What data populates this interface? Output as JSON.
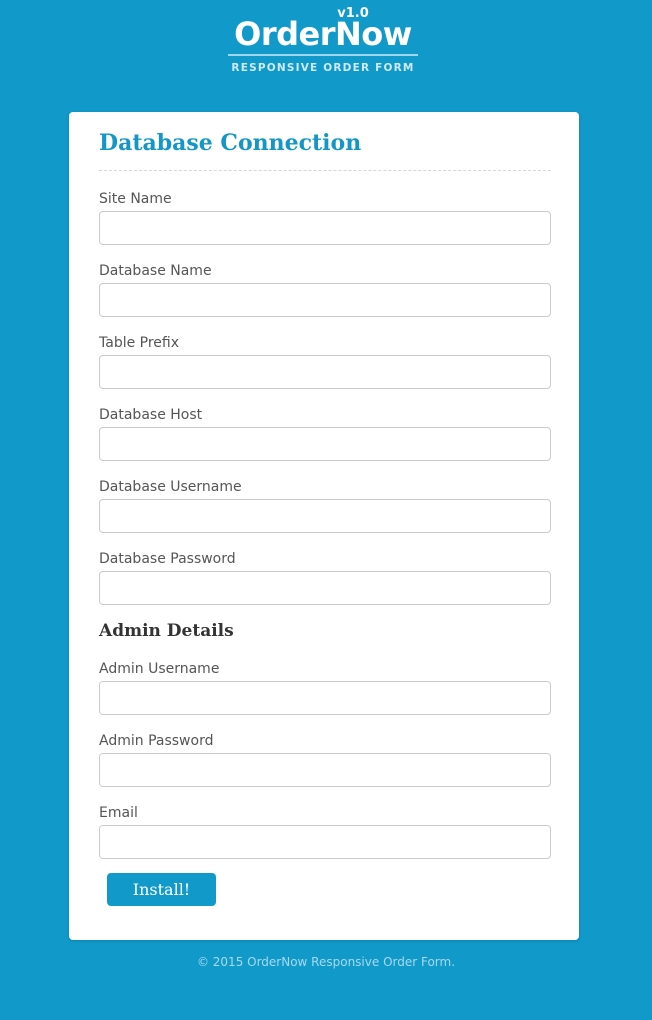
{
  "logo": {
    "version": "v1.0",
    "title": "OrderNow",
    "tagline": "RESPONSIVE ORDER FORM"
  },
  "form": {
    "title": "Database Connection",
    "fields": {
      "site_name": {
        "label": "Site Name",
        "value": ""
      },
      "db_name": {
        "label": "Database Name",
        "value": ""
      },
      "table_prefix": {
        "label": "Table Prefix",
        "value": ""
      },
      "db_host": {
        "label": "Database Host",
        "value": ""
      },
      "db_username": {
        "label": "Database Username",
        "value": ""
      },
      "db_password": {
        "label": "Database Password",
        "value": ""
      }
    },
    "admin_section_title": "Admin Details",
    "admin_fields": {
      "admin_username": {
        "label": "Admin Username",
        "value": ""
      },
      "admin_password": {
        "label": "Admin Password",
        "value": ""
      },
      "email": {
        "label": "Email",
        "value": ""
      }
    },
    "install_label": "Install!"
  },
  "footer": {
    "text": "© 2015 OrderNow Responsive Order Form."
  },
  "colors": {
    "background": "#1199ca",
    "accent": "#1496c7",
    "card": "#ffffff"
  }
}
